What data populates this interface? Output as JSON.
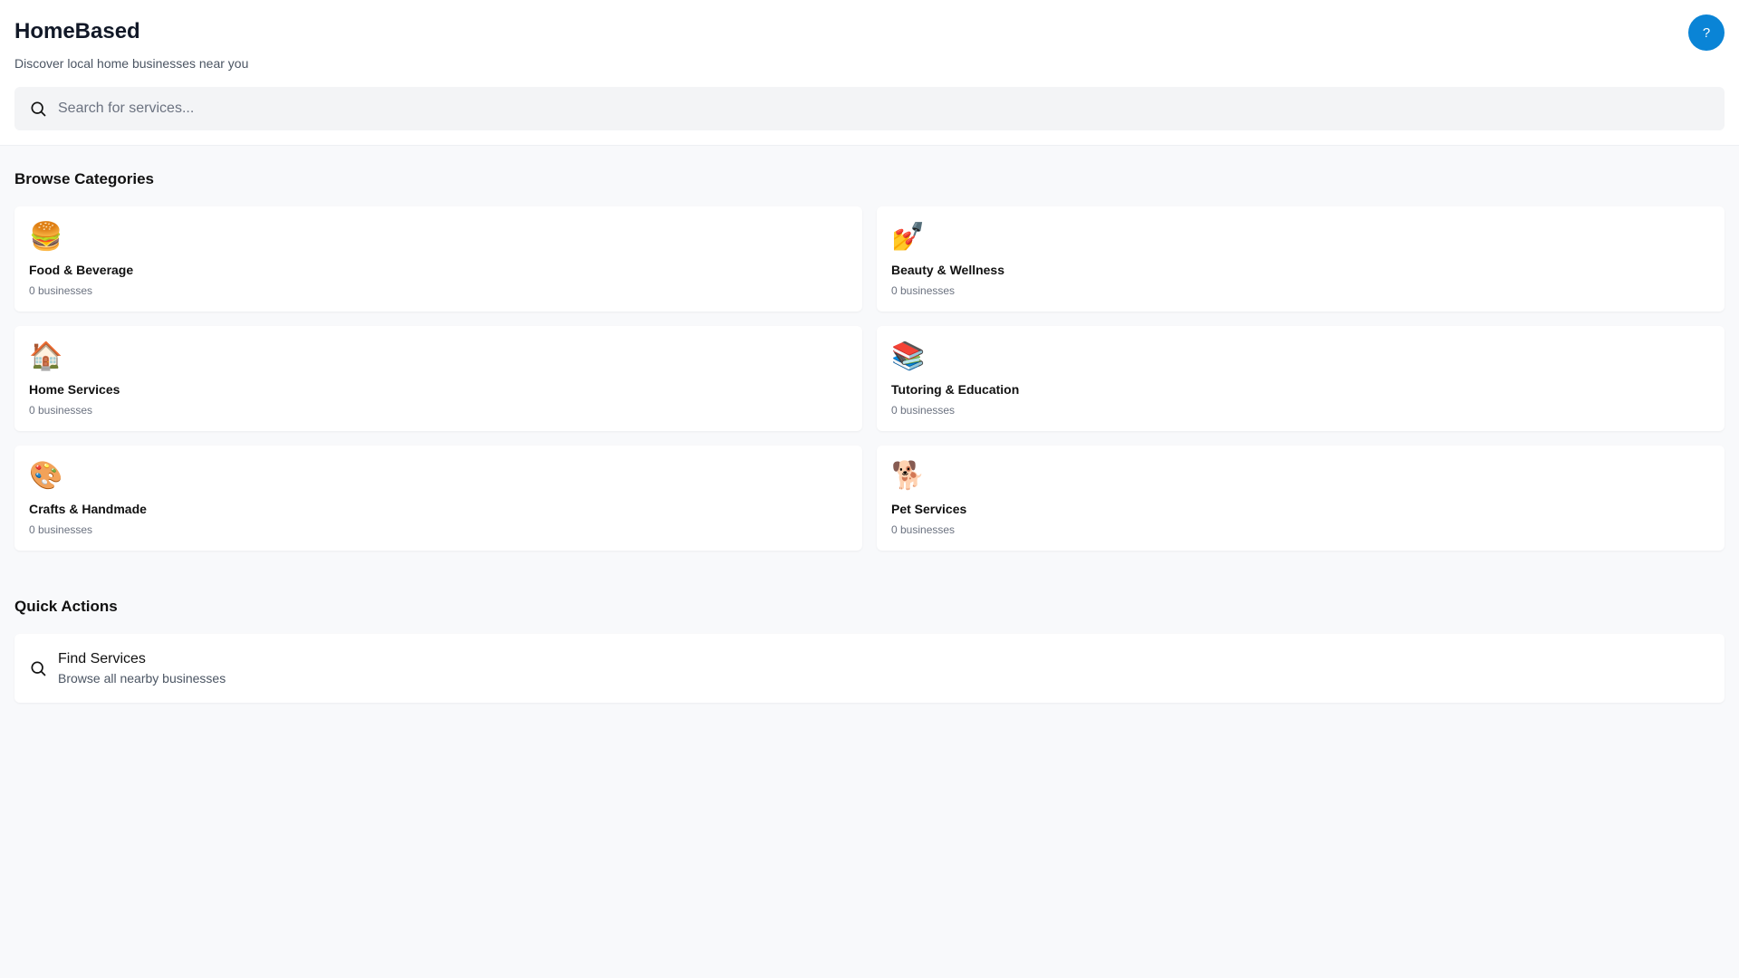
{
  "header": {
    "title": "HomeBased",
    "subtitle": "Discover local home businesses near you",
    "help_label": "?",
    "search_placeholder": "Search for services..."
  },
  "categories_section": {
    "title": "Browse Categories",
    "items": [
      {
        "icon": "🍔",
        "icon_name": "burger-icon",
        "name": "Food & Beverage",
        "count": "0 businesses"
      },
      {
        "icon": "💅",
        "icon_name": "nail-polish-icon",
        "name": "Beauty & Wellness",
        "count": "0 businesses"
      },
      {
        "icon": "🏠",
        "icon_name": "house-icon",
        "name": "Home Services",
        "count": "0 businesses"
      },
      {
        "icon": "📚",
        "icon_name": "books-icon",
        "name": "Tutoring & Education",
        "count": "0 businesses"
      },
      {
        "icon": "🎨",
        "icon_name": "palette-icon",
        "name": "Crafts & Handmade",
        "count": "0 businesses"
      },
      {
        "icon": "🐕",
        "icon_name": "dog-icon",
        "name": "Pet Services",
        "count": "0 businesses"
      }
    ]
  },
  "quick_actions": {
    "title": "Quick Actions",
    "items": [
      {
        "icon_name": "search-icon",
        "title": "Find Services",
        "description": "Browse all nearby businesses"
      }
    ]
  },
  "colors": {
    "accent": "#0a84d6",
    "background": "#f8f9fb",
    "card": "#ffffff"
  }
}
